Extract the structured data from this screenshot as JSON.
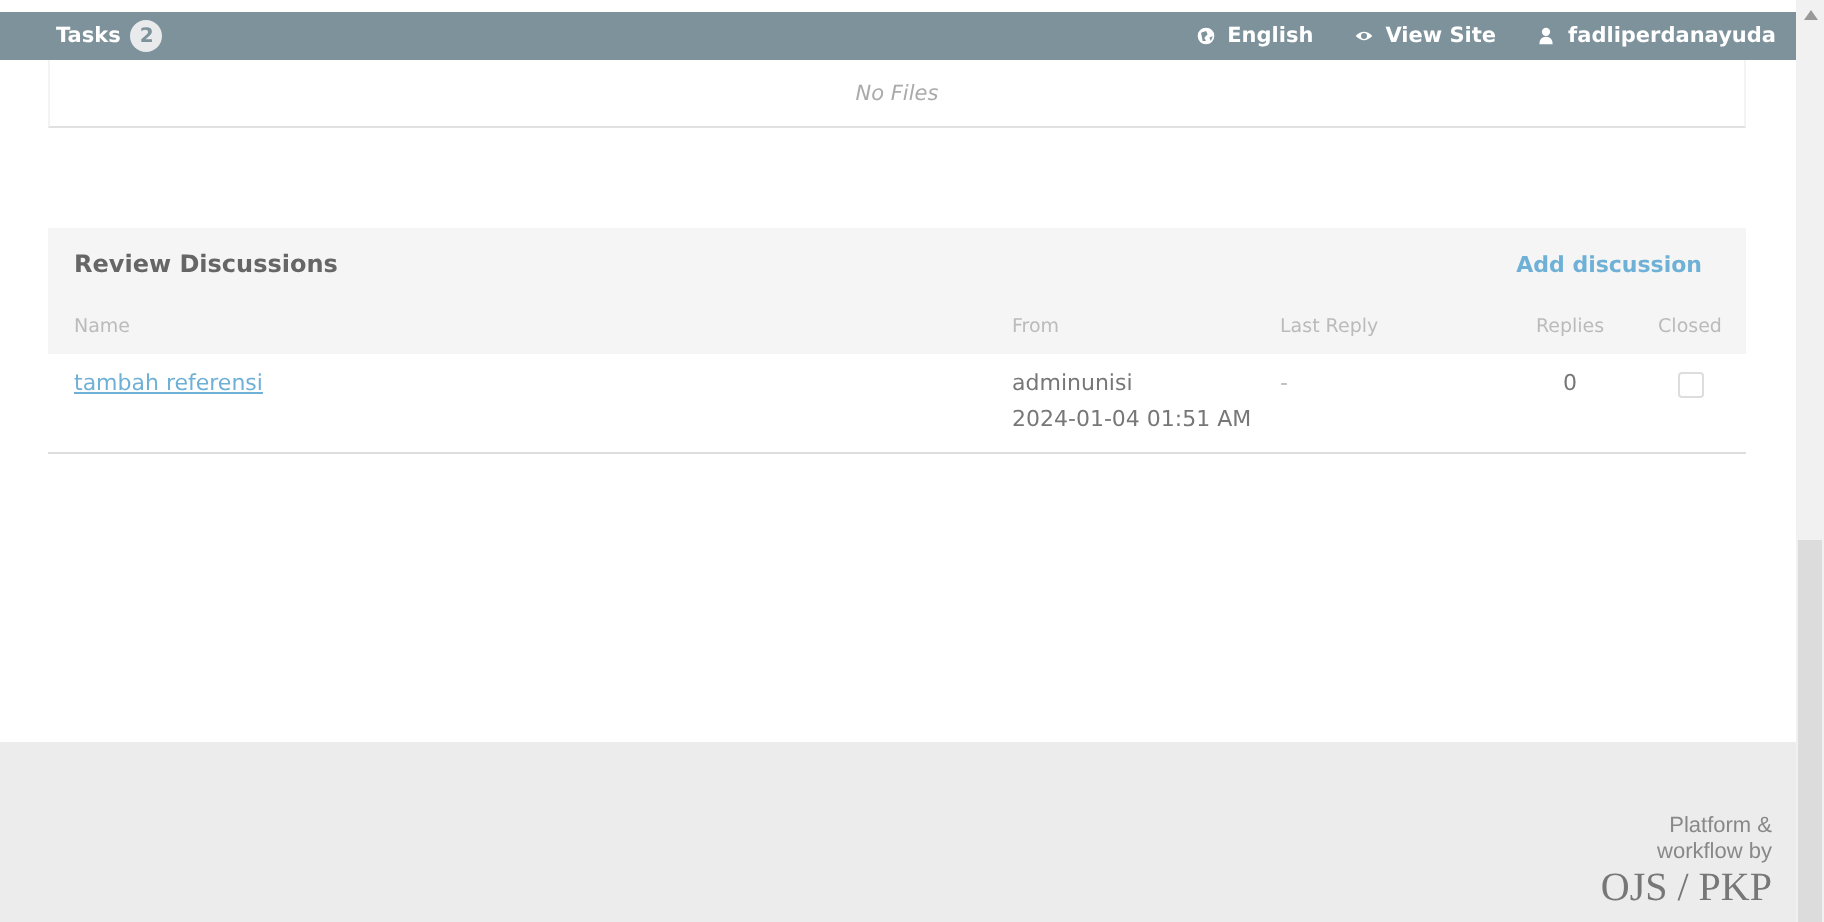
{
  "topbar": {
    "tasks_label": "Tasks",
    "tasks_count": "2",
    "links": [
      {
        "kind": "globe",
        "label": "English"
      },
      {
        "kind": "eye",
        "label": "View Site"
      },
      {
        "kind": "user",
        "label": "fadliperdanayuda"
      }
    ]
  },
  "files": {
    "empty_text": "No Files"
  },
  "discussions": {
    "title": "Review Discussions",
    "action": "Add discussion",
    "columns": [
      "Name",
      "From",
      "Last Reply",
      "Replies",
      "Closed"
    ],
    "rows": [
      {
        "name": "tambah referensi",
        "from_user": "adminunisi",
        "from_date": "2024-01-04 01:51 AM",
        "last_reply": "-",
        "replies": "0",
        "closed": false
      }
    ]
  },
  "footer": {
    "tagline_line1": "Platform &",
    "tagline_line2": "workflow by",
    "brand": "OJS / PKP"
  }
}
